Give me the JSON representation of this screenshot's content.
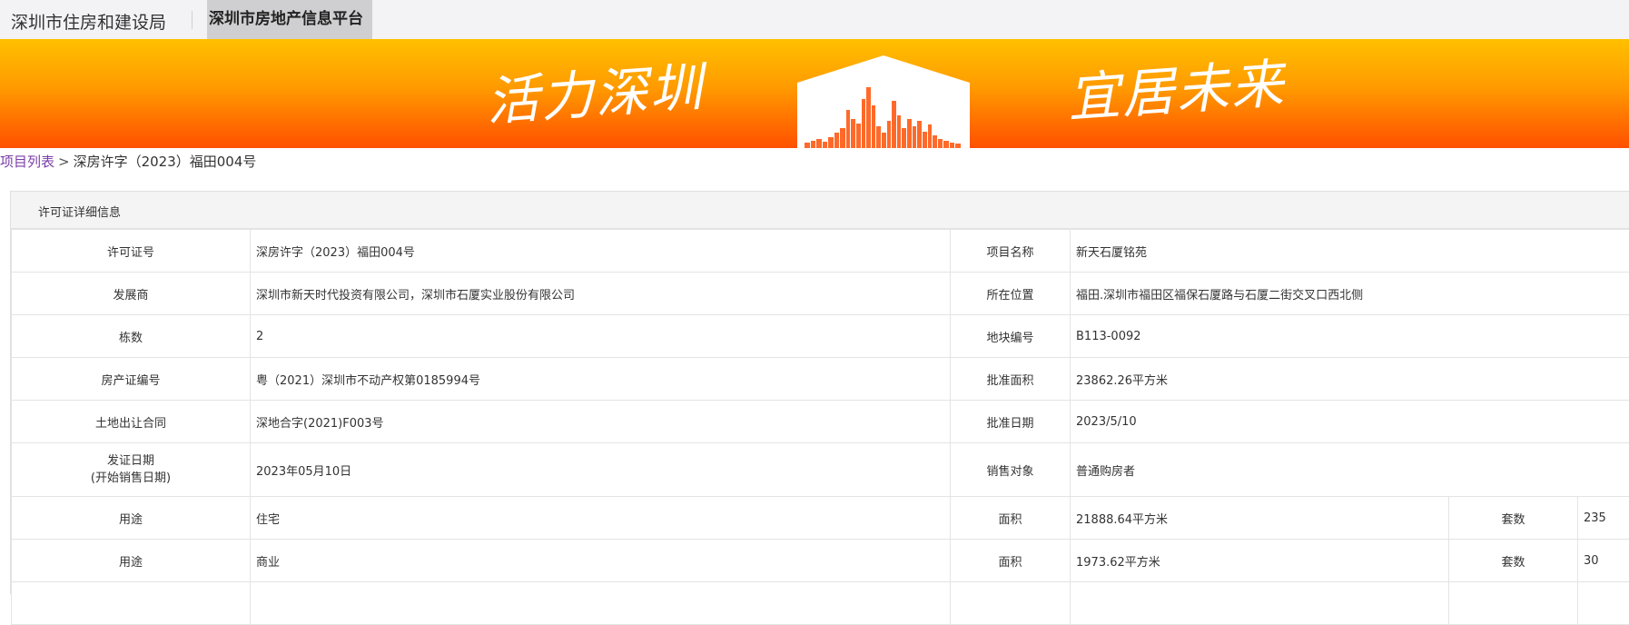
{
  "header": {
    "bureau_link": "深圳市住房和建设局",
    "platform_title": "深圳市房地产信息平台"
  },
  "banner": {
    "slogan_left": "活力深圳",
    "slogan_right": "宜居未来"
  },
  "breadcrumb": {
    "link": "项目列表",
    "separator": ">",
    "current": "深房许字（2023）福田004号"
  },
  "panel": {
    "title": "许可证详细信息"
  },
  "details": {
    "permit_no_label": "许可证号",
    "permit_no_value": "深房许字（2023）福田004号",
    "project_name_label": "项目名称",
    "project_name_value": "新天石厦铭苑",
    "developer_label": "发展商",
    "developer_value": "深圳市新天时代投资有限公司，深圳市石厦实业股份有限公司",
    "location_label": "所在位置",
    "location_value": "福田.深圳市福田区福保石厦路与石厦二街交叉口西北侧",
    "buildings_label": "栋数",
    "buildings_value": "2",
    "plot_no_label": "地块编号",
    "plot_no_value": "B113-0092",
    "property_cert_label": "房产证编号",
    "property_cert_value": "粤（2021）深圳市不动产权第0185994号",
    "approved_area_label": "批准面积",
    "approved_area_value": "23862.26平方米",
    "land_contract_label": "土地出让合同",
    "land_contract_value": "深地合字(2021)F003号",
    "approval_date_label": "批准日期",
    "approval_date_value": "2023/5/10",
    "issue_date_label_1": "发证日期",
    "issue_date_label_2": "(开始销售日期)",
    "issue_date_value": "2023年05月10日",
    "sales_target_label": "销售对象",
    "sales_target_value": "普通购房者"
  },
  "usage_rows": [
    {
      "use_label": "用途",
      "use_value": "住宅",
      "area_label": "面积",
      "area_value": "21888.64平方米",
      "units_label": "套数",
      "units_value": "235"
    },
    {
      "use_label": "用途",
      "use_value": "商业",
      "area_label": "面积",
      "area_value": "1973.62平方米",
      "units_label": "套数",
      "units_value": "30"
    }
  ]
}
